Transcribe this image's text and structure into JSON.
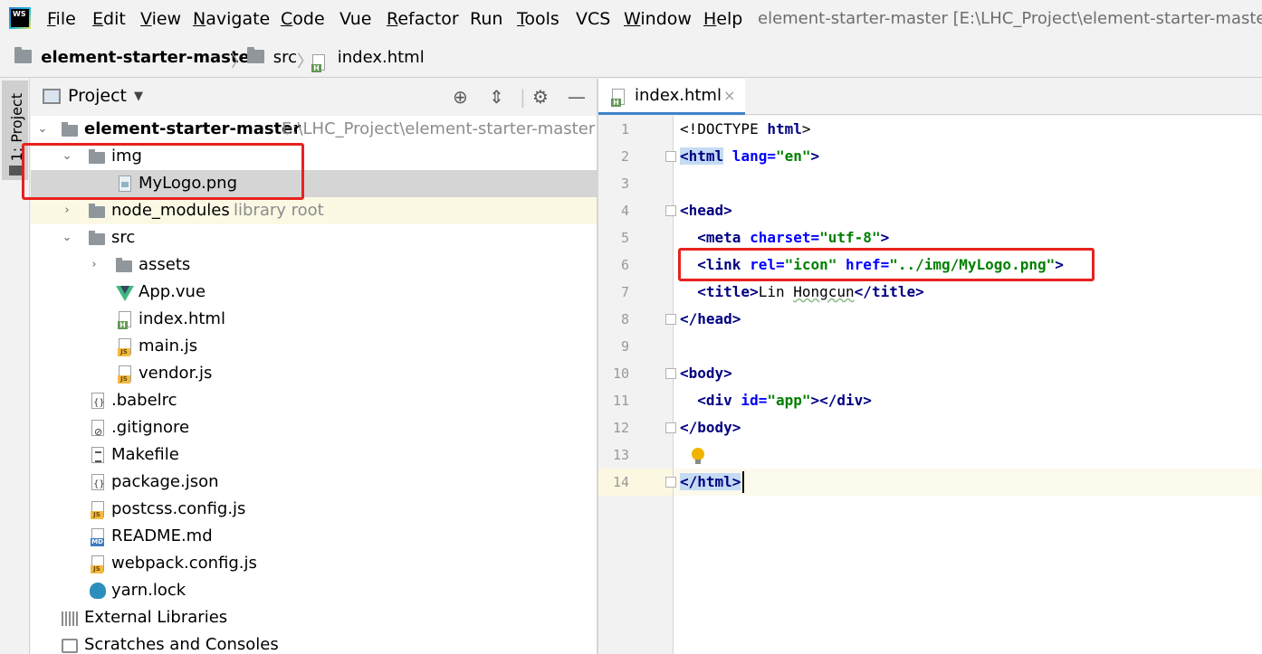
{
  "menu": {
    "app_icon_text": "WS",
    "items": [
      {
        "label": "File",
        "mnemonic": "F",
        "rest": "ile"
      },
      {
        "label": "Edit",
        "mnemonic": "E",
        "rest": "dit"
      },
      {
        "label": "View",
        "mnemonic": "V",
        "rest": "iew"
      },
      {
        "label": "Navigate",
        "mnemonic": "N",
        "rest": "avigate"
      },
      {
        "label": "Code",
        "mnemonic": "C",
        "rest": "ode"
      },
      {
        "label": "Vue",
        "mnemonic": "",
        "rest": "Vue"
      },
      {
        "label": "Refactor",
        "mnemonic": "R",
        "rest": "efactor"
      },
      {
        "label": "Run",
        "mnemonic": "",
        "rest": "Run"
      },
      {
        "label": "Tools",
        "mnemonic": "T",
        "rest": "ools"
      },
      {
        "label": "VCS",
        "mnemonic": "",
        "rest": "VCS"
      },
      {
        "label": "Window",
        "mnemonic": "W",
        "rest": "indow"
      },
      {
        "label": "Help",
        "mnemonic": "H",
        "rest": "elp"
      }
    ],
    "window_title": "element-starter-master [E:\\LHC_Project\\element-starter-master]"
  },
  "breadcrumb": {
    "items": [
      "element-starter-master",
      "src",
      "index.html"
    ]
  },
  "tool_window": {
    "tab_label": "1: Project"
  },
  "project_panel": {
    "title": "Project",
    "tree": [
      {
        "label": "element-starter-master",
        "hint": "E:\\LHC_Project\\element-starter-master"
      },
      {
        "label": "img",
        "hint": ""
      },
      {
        "label": "MyLogo.png",
        "hint": ""
      },
      {
        "label": "node_modules",
        "hint": "library root"
      },
      {
        "label": "src",
        "hint": ""
      },
      {
        "label": "assets",
        "hint": ""
      },
      {
        "label": "App.vue",
        "hint": ""
      },
      {
        "label": "index.html",
        "hint": ""
      },
      {
        "label": "main.js",
        "hint": ""
      },
      {
        "label": "vendor.js",
        "hint": ""
      },
      {
        "label": ".babelrc",
        "hint": ""
      },
      {
        "label": ".gitignore",
        "hint": ""
      },
      {
        "label": "Makefile",
        "hint": ""
      },
      {
        "label": "package.json",
        "hint": ""
      },
      {
        "label": "postcss.config.js",
        "hint": ""
      },
      {
        "label": "README.md",
        "hint": ""
      },
      {
        "label": "webpack.config.js",
        "hint": ""
      },
      {
        "label": "yarn.lock",
        "hint": ""
      },
      {
        "label": "External Libraries",
        "hint": ""
      },
      {
        "label": "Scratches and Consoles",
        "hint": ""
      }
    ]
  },
  "editor": {
    "tab_label": "index.html",
    "tab_close": "×",
    "line_numbers": [
      "1",
      "2",
      "3",
      "4",
      "5",
      "6",
      "7",
      "8",
      "9",
      "10",
      "11",
      "12",
      "13",
      "14"
    ],
    "lines": {
      "l1_a": "<!DOCTYPE ",
      "l1_b": "html",
      "l1_c": ">",
      "l2_a": "<html",
      "l2_b": " lang=",
      "l2_c": "\"en\"",
      "l2_d": ">",
      "l4_a": "<head",
      "l4_b": ">",
      "l5_a": "  <meta",
      "l5_b": " charset=",
      "l5_c": "\"utf-8\"",
      "l5_d": ">",
      "l6_a": "  <link",
      "l6_b": " rel=",
      "l6_c": "\"icon\"",
      "l6_d": " href=",
      "l6_e": "\"../img/MyLogo.png\"",
      "l6_f": ">",
      "l7_a": "  <title",
      "l7_b": ">",
      "l7_c": "Lin ",
      "l7_d": "Hongcun",
      "l7_e": "</title",
      "l7_f": ">",
      "l8_a": "</head",
      "l8_b": ">",
      "l10_a": "<body",
      "l10_b": ">",
      "l11_a": "  <div",
      "l11_b": " id=",
      "l11_c": "\"app\"",
      "l11_d": "></div",
      "l11_e": ">",
      "l12_a": "</body",
      "l12_b": ">",
      "l14_a": "</html",
      "l14_b": ">"
    }
  },
  "colors": {
    "highlight_box": "#e8211d",
    "tag": "#000080",
    "attribute": "#0000ff",
    "value": "#008000",
    "selection": "#d5d5d5"
  }
}
